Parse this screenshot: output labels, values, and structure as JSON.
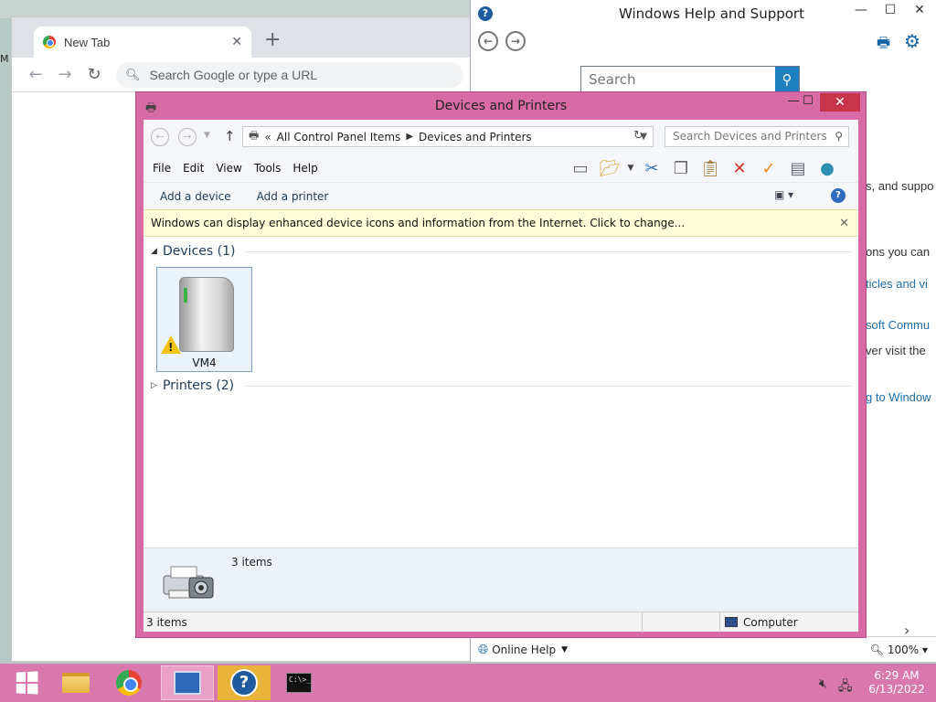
{
  "desktop": {
    "icon_label": "M"
  },
  "chrome": {
    "tab_title": "New Tab",
    "tab_close": "✕",
    "new_tab": "+",
    "omnibox_placeholder": "Search Google or type a URL"
  },
  "help": {
    "title": "Windows Help and Support",
    "search_placeholder": "Search",
    "fragments": [
      "s, and suppo",
      "ons you can",
      "ticles and vi",
      "soft Commu",
      "ver visit the",
      "g to Window"
    ],
    "online_help": "Online Help",
    "zoom": "100%"
  },
  "devices_printers": {
    "title": "Devices and Printers",
    "breadcrumb": [
      "All Control Panel Items",
      "Devices and Printers"
    ],
    "search_placeholder": "Search Devices and Printers",
    "menu": [
      "File",
      "Edit",
      "View",
      "Tools",
      "Help"
    ],
    "commands": [
      "Add a device",
      "Add a printer"
    ],
    "info_bar": "Windows can display enhanced device icons and information from the Internet. Click to change...",
    "groups": {
      "devices": "Devices (1)",
      "printers": "Printers (2)"
    },
    "device_label": "VM4",
    "details_count": "3 items",
    "status_items": "3 items",
    "status_location": "Computer"
  },
  "taskbar": {
    "time": "6:29 AM",
    "date": "6/13/2022",
    "help_glyph": "?",
    "cmd_glyph": "C:\\>_"
  },
  "colors": {
    "window_frame": "#d86aa6",
    "taskbar": "#d978ad",
    "close_button": "#c7354a",
    "link": "#1e6fa8"
  },
  "icons": [
    "chrome-logo",
    "back-arrow",
    "forward-arrow",
    "reload",
    "search",
    "print",
    "gear",
    "printer",
    "warning",
    "windows-logo"
  ]
}
